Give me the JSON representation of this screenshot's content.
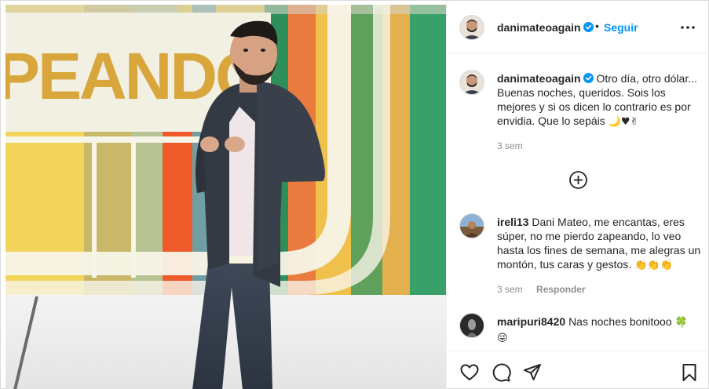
{
  "post": {
    "author": "danimateoagain",
    "follow_label": "Seguir",
    "separator": "•",
    "photo_sign_text": "PEANDO",
    "caption": {
      "username": "danimateoagain",
      "text": "Otro día, otro dólar... Buenas noches, queridos. Sois los mejores y si os dicen lo contrario es por envidia. Que lo sepáis",
      "emojis": "🌙♥✌",
      "time": "3 sem"
    }
  },
  "comments": [
    {
      "username": "ireli13",
      "text": "Dani Mateo, me encantas, eres súper, no me pierdo zapeando, lo veo hasta los fines de semana, me alegras un montón, tus caras y gestos.",
      "emojis": "👏👏👏",
      "time": "3 sem",
      "reply_label": "Responder"
    },
    {
      "username": "maripuri8420",
      "text": "Nas noches bonitooo",
      "emojis": "🍀",
      "emojis2": "😜"
    }
  ],
  "icons": {
    "more": "more-options-icon",
    "verified": "verified-badge-icon",
    "load_more": "plus-circle-icon",
    "like": "heart-icon",
    "comment": "comment-icon",
    "share": "share-icon",
    "save": "bookmark-icon"
  },
  "colors": {
    "accent": "#0095f6",
    "verified": "#0095f6",
    "text": "#262626",
    "muted": "#8e8e8e"
  }
}
